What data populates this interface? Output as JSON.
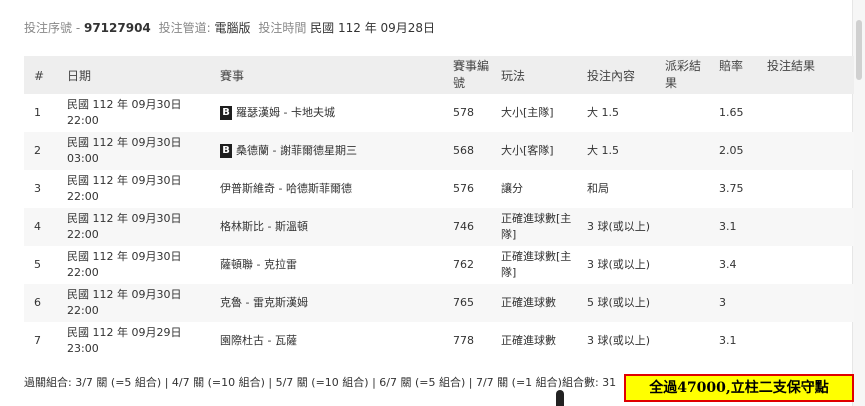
{
  "info": {
    "serial_label": "投注序號 -",
    "serial_value": "97127904",
    "channel_label": "投注管道:",
    "channel_value": "電腦版",
    "time_label": "投注時間",
    "time_value": "民國 112 年 09月28日"
  },
  "table": {
    "headers": [
      "#",
      "日期",
      "賽事",
      "賽事編號",
      "玩法",
      "投注內容",
      "派彩結果",
      "賠率",
      "投注結果"
    ],
    "rows": [
      {
        "num": "1",
        "date": "民國 112 年 09月30日",
        "time": "22:00",
        "badge": "B",
        "match": "羅瑟漢姆 - 卡地夫城",
        "code": "578",
        "play": "大小[主隊]",
        "content": "大 1.5",
        "payout": "",
        "odds": "1.65",
        "result": ""
      },
      {
        "num": "2",
        "date": "民國 112 年 09月30日",
        "time": "03:00",
        "badge": "B",
        "match": "桑德蘭 - 謝菲爾德星期三",
        "code": "568",
        "play": "大小[客隊]",
        "content": "大 1.5",
        "payout": "",
        "odds": "2.05",
        "result": ""
      },
      {
        "num": "3",
        "date": "民國 112 年 09月30日",
        "time": "22:00",
        "badge": "",
        "match": "伊普斯維奇 - 哈德斯菲爾德",
        "code": "576",
        "play": "讓分",
        "content": "和局",
        "payout": "",
        "odds": "3.75",
        "result": ""
      },
      {
        "num": "4",
        "date": "民國 112 年 09月30日",
        "time": "22:00",
        "badge": "",
        "match": "格林斯比 - 斯溫頓",
        "code": "746",
        "play": "正確進球數[主隊]",
        "content": "3 球(或以上)",
        "payout": "",
        "odds": "3.1",
        "result": ""
      },
      {
        "num": "5",
        "date": "民國 112 年 09月30日",
        "time": "22:00",
        "badge": "",
        "match": "薩頓聯 - 克拉雷",
        "code": "762",
        "play": "正確進球數[主隊]",
        "content": "3 球(或以上)",
        "payout": "",
        "odds": "3.4",
        "result": ""
      },
      {
        "num": "6",
        "date": "民國 112 年 09月30日",
        "time": "22:00",
        "badge": "",
        "match": "克魯 - 雷克斯漢姆",
        "code": "765",
        "play": "正確進球數",
        "content": "5 球(或以上)",
        "payout": "",
        "odds": "3",
        "result": ""
      },
      {
        "num": "7",
        "date": "民國 112 年 09月29日",
        "time": "23:00",
        "badge": "",
        "match": "園際杜古 - 瓦薩",
        "code": "778",
        "play": "正確進球數",
        "content": "3 球(或以上)",
        "payout": "",
        "odds": "3.1",
        "result": ""
      }
    ]
  },
  "summary": "過關組合: 3/7 關 (=5 組合) | 4/7 關 (=10 組合) | 5/7 關 (=10 組合) | 6/7 關 (=5 組合) | 7/7 關 (=1 組合)組合數: 31",
  "notice": "全過47000,立柱二支保守點"
}
